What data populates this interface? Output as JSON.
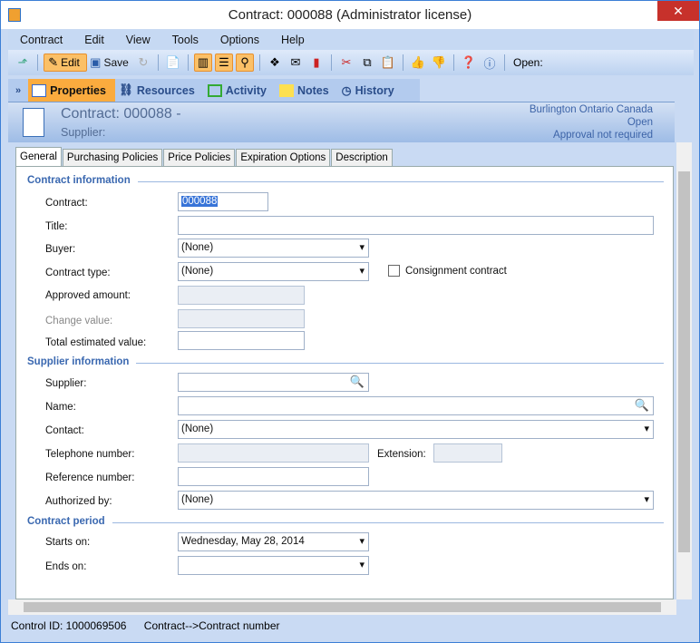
{
  "window": {
    "title": "Contract: 000088 (Administrator license)",
    "close": "✕"
  },
  "menu": [
    "Contract",
    "Edit",
    "View",
    "Tools",
    "Options",
    "Help"
  ],
  "toolbar": {
    "edit": "Edit",
    "save": "Save",
    "open": "Open:"
  },
  "nav": [
    "Properties",
    "Resources",
    "Activity",
    "Notes",
    "History"
  ],
  "header": {
    "title": "Contract: 000088 -",
    "supplier": "Supplier:",
    "location": "Burlington Ontario Canada",
    "status": "Open",
    "approval": "Approval not required"
  },
  "tabs": [
    "General",
    "Purchasing Policies",
    "Price Policies",
    "Expiration Options",
    "Description"
  ],
  "sections": {
    "contract": "Contract information",
    "supplier": "Supplier information",
    "period": "Contract period"
  },
  "fields": {
    "contract": {
      "label": "Contract:",
      "value": "000088"
    },
    "title": {
      "label": "Title:",
      "value": ""
    },
    "buyer": {
      "label": "Buyer:",
      "value": "(None)"
    },
    "type": {
      "label": "Contract type:",
      "value": "(None)"
    },
    "consignment": {
      "label": "Consignment contract",
      "checked": false
    },
    "approved": {
      "label": "Approved amount:",
      "value": ""
    },
    "change": {
      "label": "Change value:",
      "value": ""
    },
    "total": {
      "label": "Total estimated value:",
      "value": ""
    },
    "supplier": {
      "label": "Supplier:",
      "value": ""
    },
    "name": {
      "label": "Name:",
      "value": ""
    },
    "contact": {
      "label": "Contact:",
      "value": "(None)"
    },
    "phone": {
      "label": "Telephone number:",
      "value": ""
    },
    "extension": {
      "label": "Extension:",
      "value": ""
    },
    "reference": {
      "label": "Reference number:",
      "value": ""
    },
    "authorized": {
      "label": "Authorized by:",
      "value": "(None)"
    },
    "starts": {
      "label": "Starts on:",
      "value": "Wednesday, May 28, 2014"
    },
    "ends": {
      "label": "Ends on:",
      "value": ""
    }
  },
  "status": {
    "control_id": "Control ID: 1000069506",
    "path": "Contract-->Contract number"
  }
}
